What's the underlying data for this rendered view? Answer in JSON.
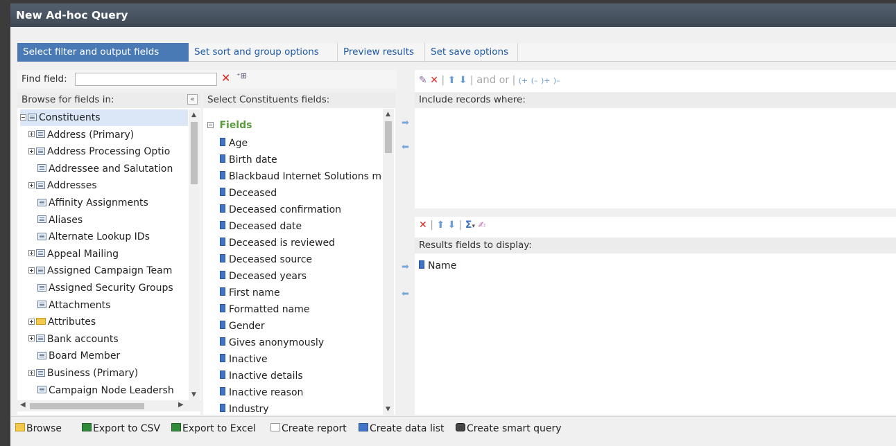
{
  "window": {
    "title": "New Ad-hoc Query"
  },
  "tabs": [
    "Select filter and output fields",
    "Set sort and group options",
    "Preview results",
    "Set save options"
  ],
  "find_field": {
    "label": "Find field:",
    "value": ""
  },
  "browse": {
    "header": "Browse for fields in:",
    "collapse_glyph": "«",
    "items": [
      {
        "label": "Constituents",
        "expander": "minus",
        "icon": "table"
      },
      {
        "label": "Address (Primary)",
        "expander": "plus",
        "icon": "table"
      },
      {
        "label": "Address Processing Optio",
        "expander": "plus",
        "icon": "table"
      },
      {
        "label": "Addressee and Salutation",
        "expander": "none",
        "icon": "table"
      },
      {
        "label": "Addresses",
        "expander": "plus",
        "icon": "table"
      },
      {
        "label": "Affinity Assignments",
        "expander": "none",
        "icon": "table"
      },
      {
        "label": "Aliases",
        "expander": "none",
        "icon": "table"
      },
      {
        "label": "Alternate Lookup IDs",
        "expander": "none",
        "icon": "table"
      },
      {
        "label": "Appeal Mailing",
        "expander": "plus",
        "icon": "table"
      },
      {
        "label": "Assigned Campaign Team",
        "expander": "plus",
        "icon": "table"
      },
      {
        "label": "Assigned Security Groups",
        "expander": "none",
        "icon": "table"
      },
      {
        "label": "Attachments",
        "expander": "none",
        "icon": "table"
      },
      {
        "label": "Attributes",
        "expander": "plus",
        "icon": "folder"
      },
      {
        "label": "Bank accounts",
        "expander": "plus",
        "icon": "table"
      },
      {
        "label": "Board Member",
        "expander": "none",
        "icon": "table"
      },
      {
        "label": "Business (Primary)",
        "expander": "plus",
        "icon": "table"
      },
      {
        "label": "Campaign Node Leadersh",
        "expander": "none",
        "icon": "table"
      }
    ]
  },
  "fields_panel": {
    "header": "Select Constituents fields:",
    "group_label": "Fields",
    "items": [
      "Age",
      "Birth date",
      "Blackbaud Internet Solutions me",
      "Deceased",
      "Deceased confirmation",
      "Deceased date",
      "Deceased is reviewed",
      "Deceased source",
      "Deceased years",
      "First name",
      "Formatted name",
      "Gender",
      "Gives anonymously",
      "Inactive",
      "Inactive details",
      "Inactive reason",
      "Industry"
    ]
  },
  "filter": {
    "header": "Include records where:",
    "toolbar": {
      "and_label": "and",
      "or_label": "or",
      "paren_open": "(+",
      "paren_open_neg": "(–",
      "paren_close": ")+",
      "paren_close_neg": ")–"
    }
  },
  "results": {
    "header": "Results fields to display:",
    "items": [
      "Name"
    ],
    "sum_label": "Σ"
  },
  "footer": {
    "buttons": [
      "Browse",
      "Export to CSV",
      "Export to Excel",
      "Create report",
      "Create data list",
      "Create smart query"
    ]
  },
  "colors": {
    "accent": "#4a7ab6",
    "fields_group": "#5a9a3c",
    "delete": "#d9261c"
  }
}
